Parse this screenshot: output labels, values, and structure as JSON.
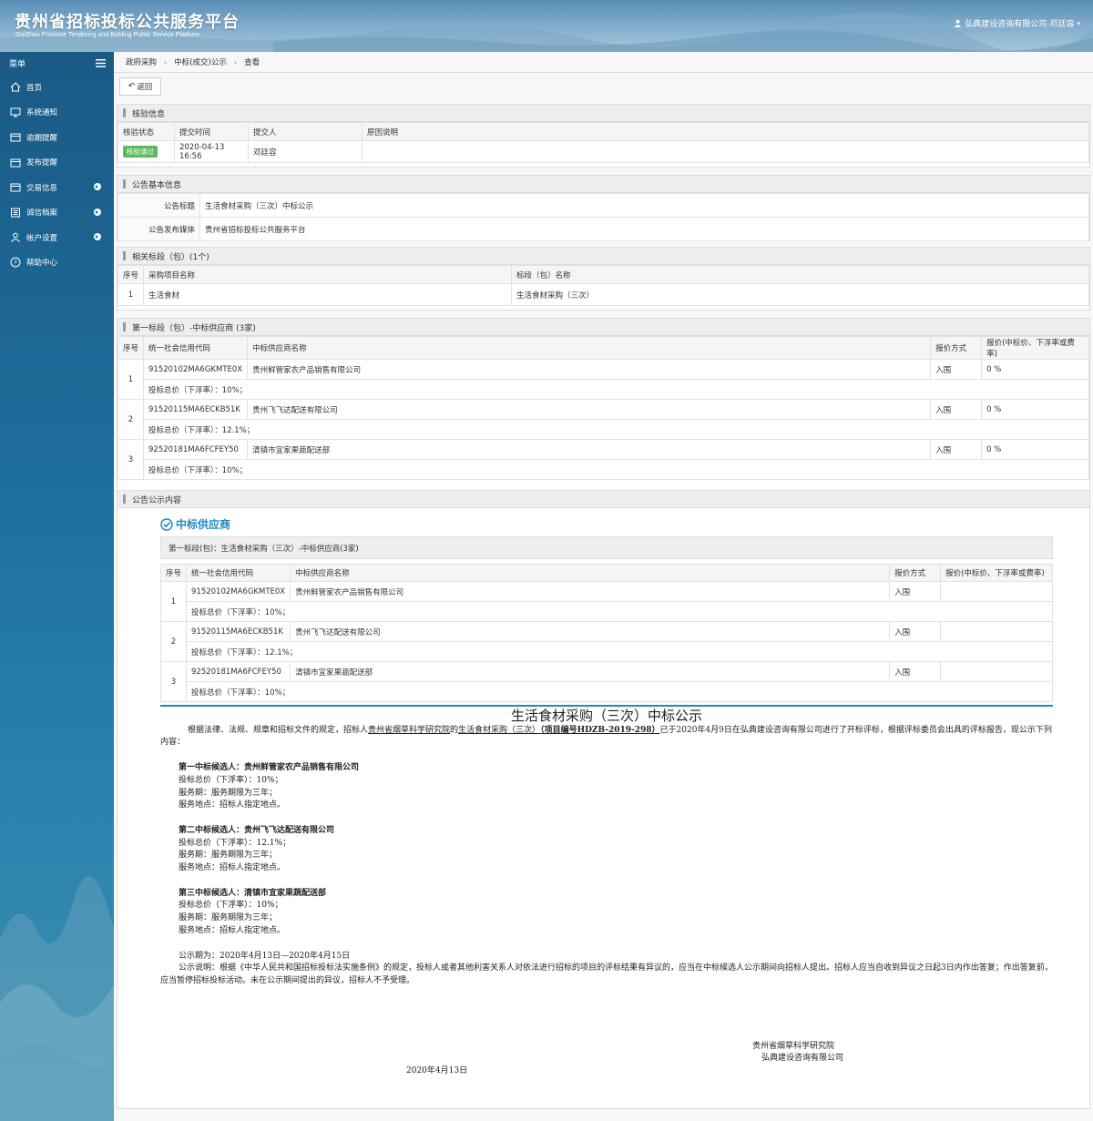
{
  "header": {
    "title_cn": "贵州省招标投标公共服务平台",
    "title_en": "GuiZhou Province Tendering and Bidding Public Service Platform",
    "user": "弘典建设咨询有限公司-邓廷容"
  },
  "sidebar": {
    "title": "菜单",
    "items": [
      {
        "label": "首页",
        "icon": "home-icon"
      },
      {
        "label": "系统通知",
        "icon": "monitor-icon"
      },
      {
        "label": "逾期提醒",
        "icon": "calendar-icon"
      },
      {
        "label": "发布提醒",
        "icon": "calendar-icon"
      },
      {
        "label": "交易信息",
        "icon": "calendar-icon"
      },
      {
        "label": "诚信档案",
        "icon": "list-icon"
      },
      {
        "label": "帐户设置",
        "icon": "user-icon"
      },
      {
        "label": "帮助中心",
        "icon": "help-icon"
      }
    ]
  },
  "breadcrumb": [
    "政府采购",
    "中标(成交)公示",
    "查看"
  ],
  "back_label": "返回",
  "verify": {
    "title": "核验信息",
    "headers": [
      "核验状态",
      "提交时间",
      "提交人",
      "原因说明"
    ],
    "status": "核验通过",
    "time": "2020-04-13 16:56",
    "person": "邓廷容",
    "reason": ""
  },
  "basic": {
    "title": "公告基本信息",
    "label_title": "公告标题",
    "value_title": "生活食材采购（三次）中标公示",
    "label_media": "公告发布媒体",
    "value_media": "贵州省招标投标公共服务平台"
  },
  "sections": {
    "title": "相关标段（包）(1个)",
    "headers": [
      "序号",
      "采购项目名称",
      "标段（包）名称"
    ],
    "row": [
      "1",
      "生活食材",
      "生活食材采购（三次）"
    ]
  },
  "suppliers": {
    "title": "第一标段（包）-中标供应商 (3家)",
    "headers": [
      "序号",
      "统一社会信用代码",
      "中标供应商名称",
      "报价方式",
      "报价(中标价、下浮率或费率)"
    ],
    "rows": [
      {
        "no": "1",
        "code": "91520102MA6GKMTE0X",
        "name": "贵州鲜管家农产品销售有限公司",
        "method": "入围",
        "price": "0 %",
        "detail": "投标总价（下浮率）：10%；"
      },
      {
        "no": "2",
        "code": "91520115MA6ECKB51K",
        "name": "贵州飞飞达配送有限公司",
        "method": "入围",
        "price": "0 %",
        "detail": "投标总价（下浮率）：12.1%；"
      },
      {
        "no": "3",
        "code": "92520181MA6FCFEY50",
        "name": "清镇市宜家果蔬配送部",
        "method": "入围",
        "price": "0 %",
        "detail": "投标总价（下浮率）：10%；"
      }
    ]
  },
  "notice": {
    "title": "公告公示内容",
    "head": "中标供应商",
    "sub_title": "第一标段(包)：生活食材采购（三次）-中标供应商(3家)",
    "article_title": "生活食材采购（三次）中标公示",
    "intro_a": "根据法律、法规、规章和招标文件的规定，招标人",
    "intro_org": "贵州省烟草科学研究院",
    "intro_b": "的",
    "intro_proj": "生活食材采购（三次）",
    "intro_code": "（项目编号HDZB-2019-298）",
    "intro_c": "已于2020年4月9日在弘典建设咨询有限公司进行了开标评标，根据评标委员会出具的评标报告，现公示下列内容：",
    "candidates": [
      {
        "head": "第一中标候选人：贵州鲜管家农产品销售有限公司",
        "l1": "投标总价（下浮率）：10%；",
        "l2": "服务期：服务期限为三年；",
        "l3": "服务地点：招标人指定地点。"
      },
      {
        "head": "第二中标候选人：贵州飞飞达配送有限公司",
        "l1": "投标总价（下浮率）：12.1%；",
        "l2": "服务期：服务期限为三年；",
        "l3": "服务地点：招标人指定地点。"
      },
      {
        "head": "第三中标候选人：清镇市宜家果蔬配送部",
        "l1": "投标总价（下浮率）：10%；",
        "l2": "服务期：服务期限为三年；",
        "l3": "服务地点：招标人指定地点。"
      }
    ],
    "period": "公示期为：2020年4月13日—2020年4月15日",
    "explain": "公示说明：根据《中华人民共和国招标投标法实施条例》的规定，投标人或者其他利害关系人对依法进行招标的项目的评标结果有异议的，应当在中标候选人公示期间向招标人提出。招标人应当自收到异议之日起3日内作出答复；作出答复前，应当暂停招标投标活动。未在公示期间提出的异议，招标人不予受理。",
    "sign1": "贵州省烟草科学研究院",
    "sign2": "弘典建设咨询有限公司",
    "date": "2020年4月13日"
  }
}
